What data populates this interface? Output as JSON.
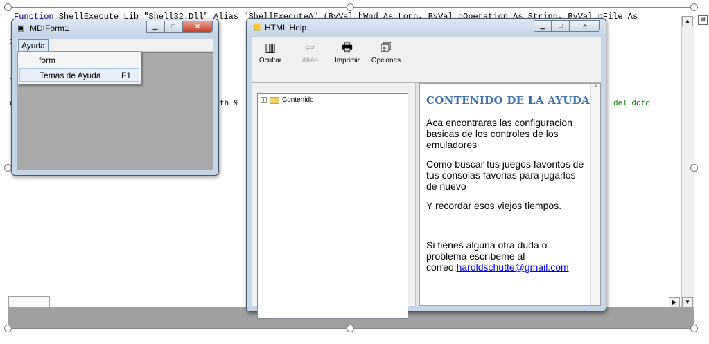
{
  "editor": {
    "code_top_keyword": "Function",
    "code_top_rest": " ShellExecute Lib \"Shell32.Dll\" Alias \"ShellExecuteA\" (ByVal hWnd As Long, ByVal pOperation As String, ByVal pFile As",
    "frag_path": "th &",
    "frag_comment": "del dcto",
    "frag_e": "e",
    "frag_1a": "1",
    "frag_1b": "1"
  },
  "mdi_window": {
    "title": "MDIForm1",
    "menu_ayuda": "Ayuda",
    "dropdown_items": [
      {
        "label": "form",
        "shortcut": ""
      },
      {
        "label": "Temas de Ayuda",
        "shortcut": "F1"
      }
    ]
  },
  "help_window": {
    "title": "HTML Help",
    "toolbar": {
      "hide": "Ocultar",
      "back": "Atrás",
      "print": "Imprimir",
      "options": "Opciones"
    },
    "tree_root": "Contenido",
    "content": {
      "heading": "CONTENIDO DE LA AYUDA",
      "p1": "Aca encontraras las configuracion basicas de los controles de los emuladores",
      "p2": "Como buscar tus juegos favoritos de tus consolas favorias para jugarlos de nuevo",
      "p3": "Y recordar esos viejos tiempos.",
      "p4": "Si tienes alguna otra duda o problema escríbeme al correo:",
      "email": "haroldschutte@gmail.com"
    }
  },
  "icons": {
    "mdi_title_icon": "form-icon",
    "help_title_icon": "help-book-icon"
  }
}
